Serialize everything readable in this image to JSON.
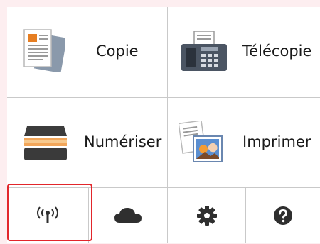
{
  "home": {
    "tiles": [
      {
        "label": "Copie",
        "icon": "copy-document-icon"
      },
      {
        "label": "Télécopie",
        "icon": "fax-machine-icon"
      },
      {
        "label": "Numériser",
        "icon": "scanner-icon"
      },
      {
        "label": "Imprimer",
        "icon": "print-photo-icon"
      }
    ],
    "bottom_buttons": [
      {
        "icon": "wireless-lan-icon",
        "selected": true
      },
      {
        "icon": "cloud-icon",
        "selected": false
      },
      {
        "icon": "settings-gear-icon",
        "selected": false
      },
      {
        "icon": "help-question-icon",
        "selected": false
      }
    ],
    "colors": {
      "highlight": "#e2262b",
      "icon_dark": "#2f2f2f",
      "background": "#fdeef0",
      "panel": "#ffffff"
    }
  }
}
